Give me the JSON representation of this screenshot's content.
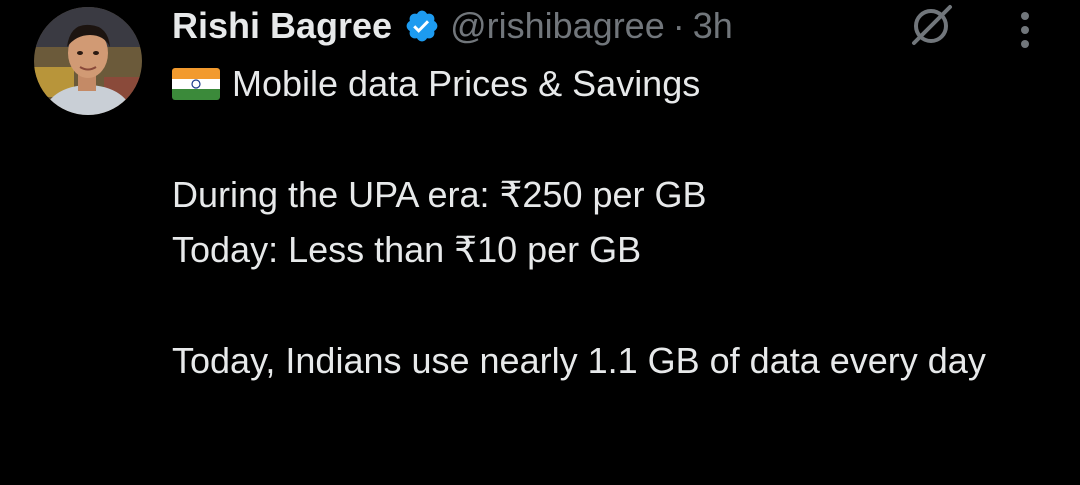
{
  "author": {
    "display_name": "Rishi Bagree",
    "handle": "@rishibagree",
    "separator": "·",
    "time_ago": "3h",
    "verified": true
  },
  "icons": {
    "avatar": "profile-photo",
    "verified": "verified-badge-icon",
    "grok": "grok-icon",
    "more": "more-vertical-icon",
    "flag": "india-flag-emoji"
  },
  "colors": {
    "background": "#000000",
    "text": "#e7e9ea",
    "secondary": "#71767b",
    "verified_blue": "#1d9bf0"
  },
  "tweet": {
    "line1": "Mobile data Prices & Savings",
    "line2": "During the UPA era: ₹250 per GB",
    "line3": "Today: Less than ₹10 per GB",
    "line4": "Today, Indians use nearly 1.1 GB of data every day"
  }
}
